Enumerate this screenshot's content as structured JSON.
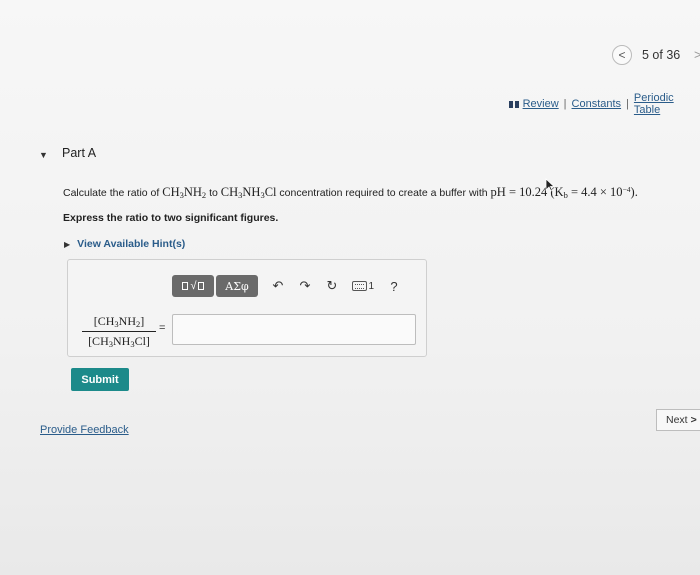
{
  "pager": {
    "prev_symbol": "<",
    "count": "5 of 36",
    "next_symbol": ">"
  },
  "resources": {
    "review": "Review",
    "constants": "Constants",
    "periodic_table": "Periodic Table",
    "separator": "|"
  },
  "part": {
    "toggle_symbol": "▼",
    "title": "Part A"
  },
  "question": {
    "lead": "Calculate the ratio of ",
    "species1_a": "CH",
    "species1_a_sub": "3",
    "species1_b": "NH",
    "species1_b_sub": "2",
    "to_word": " to ",
    "species2_a": "CH",
    "species2_a_sub": "3",
    "species2_b": "NH",
    "species2_b_sub": "3",
    "species2_c": "Cl",
    "middle": " concentration required to create a buffer with ",
    "ph_label": "pH",
    "ph_equals": " = 10.24",
    "kb_open": " (K",
    "kb_sub": "b",
    "kb_value": " = 4.4 × 10",
    "kb_exp": "−4",
    "kb_close": ")."
  },
  "instruction": "Express the ratio to two significant figures.",
  "hint": {
    "symbol": "▶",
    "label": "View Available Hint(s)"
  },
  "toolbar": {
    "templates_label": "√",
    "symbols_label": "ΑΣφ",
    "undo_symbol": "↶",
    "redo_symbol": "↷",
    "reset_symbol": "↻",
    "keyboard_suffix": "1",
    "help_symbol": "?"
  },
  "answer": {
    "num_a": "[CH",
    "num_a_sub": "3",
    "num_b": "NH",
    "num_b_sub": "2",
    "num_c": "]",
    "den_a": "[CH",
    "den_a_sub": "3",
    "den_b": "NH",
    "den_b_sub": "3",
    "den_c": "Cl]",
    "equals": "=",
    "input_value": ""
  },
  "submit_label": "Submit",
  "feedback_label": "Provide Feedback",
  "next_label": "Next",
  "next_symbol": ">",
  "colors": {
    "accent_teal": "#1c8a8a",
    "link_blue": "#2a5c8a",
    "toolbar_gray": "#6a6a6a"
  }
}
